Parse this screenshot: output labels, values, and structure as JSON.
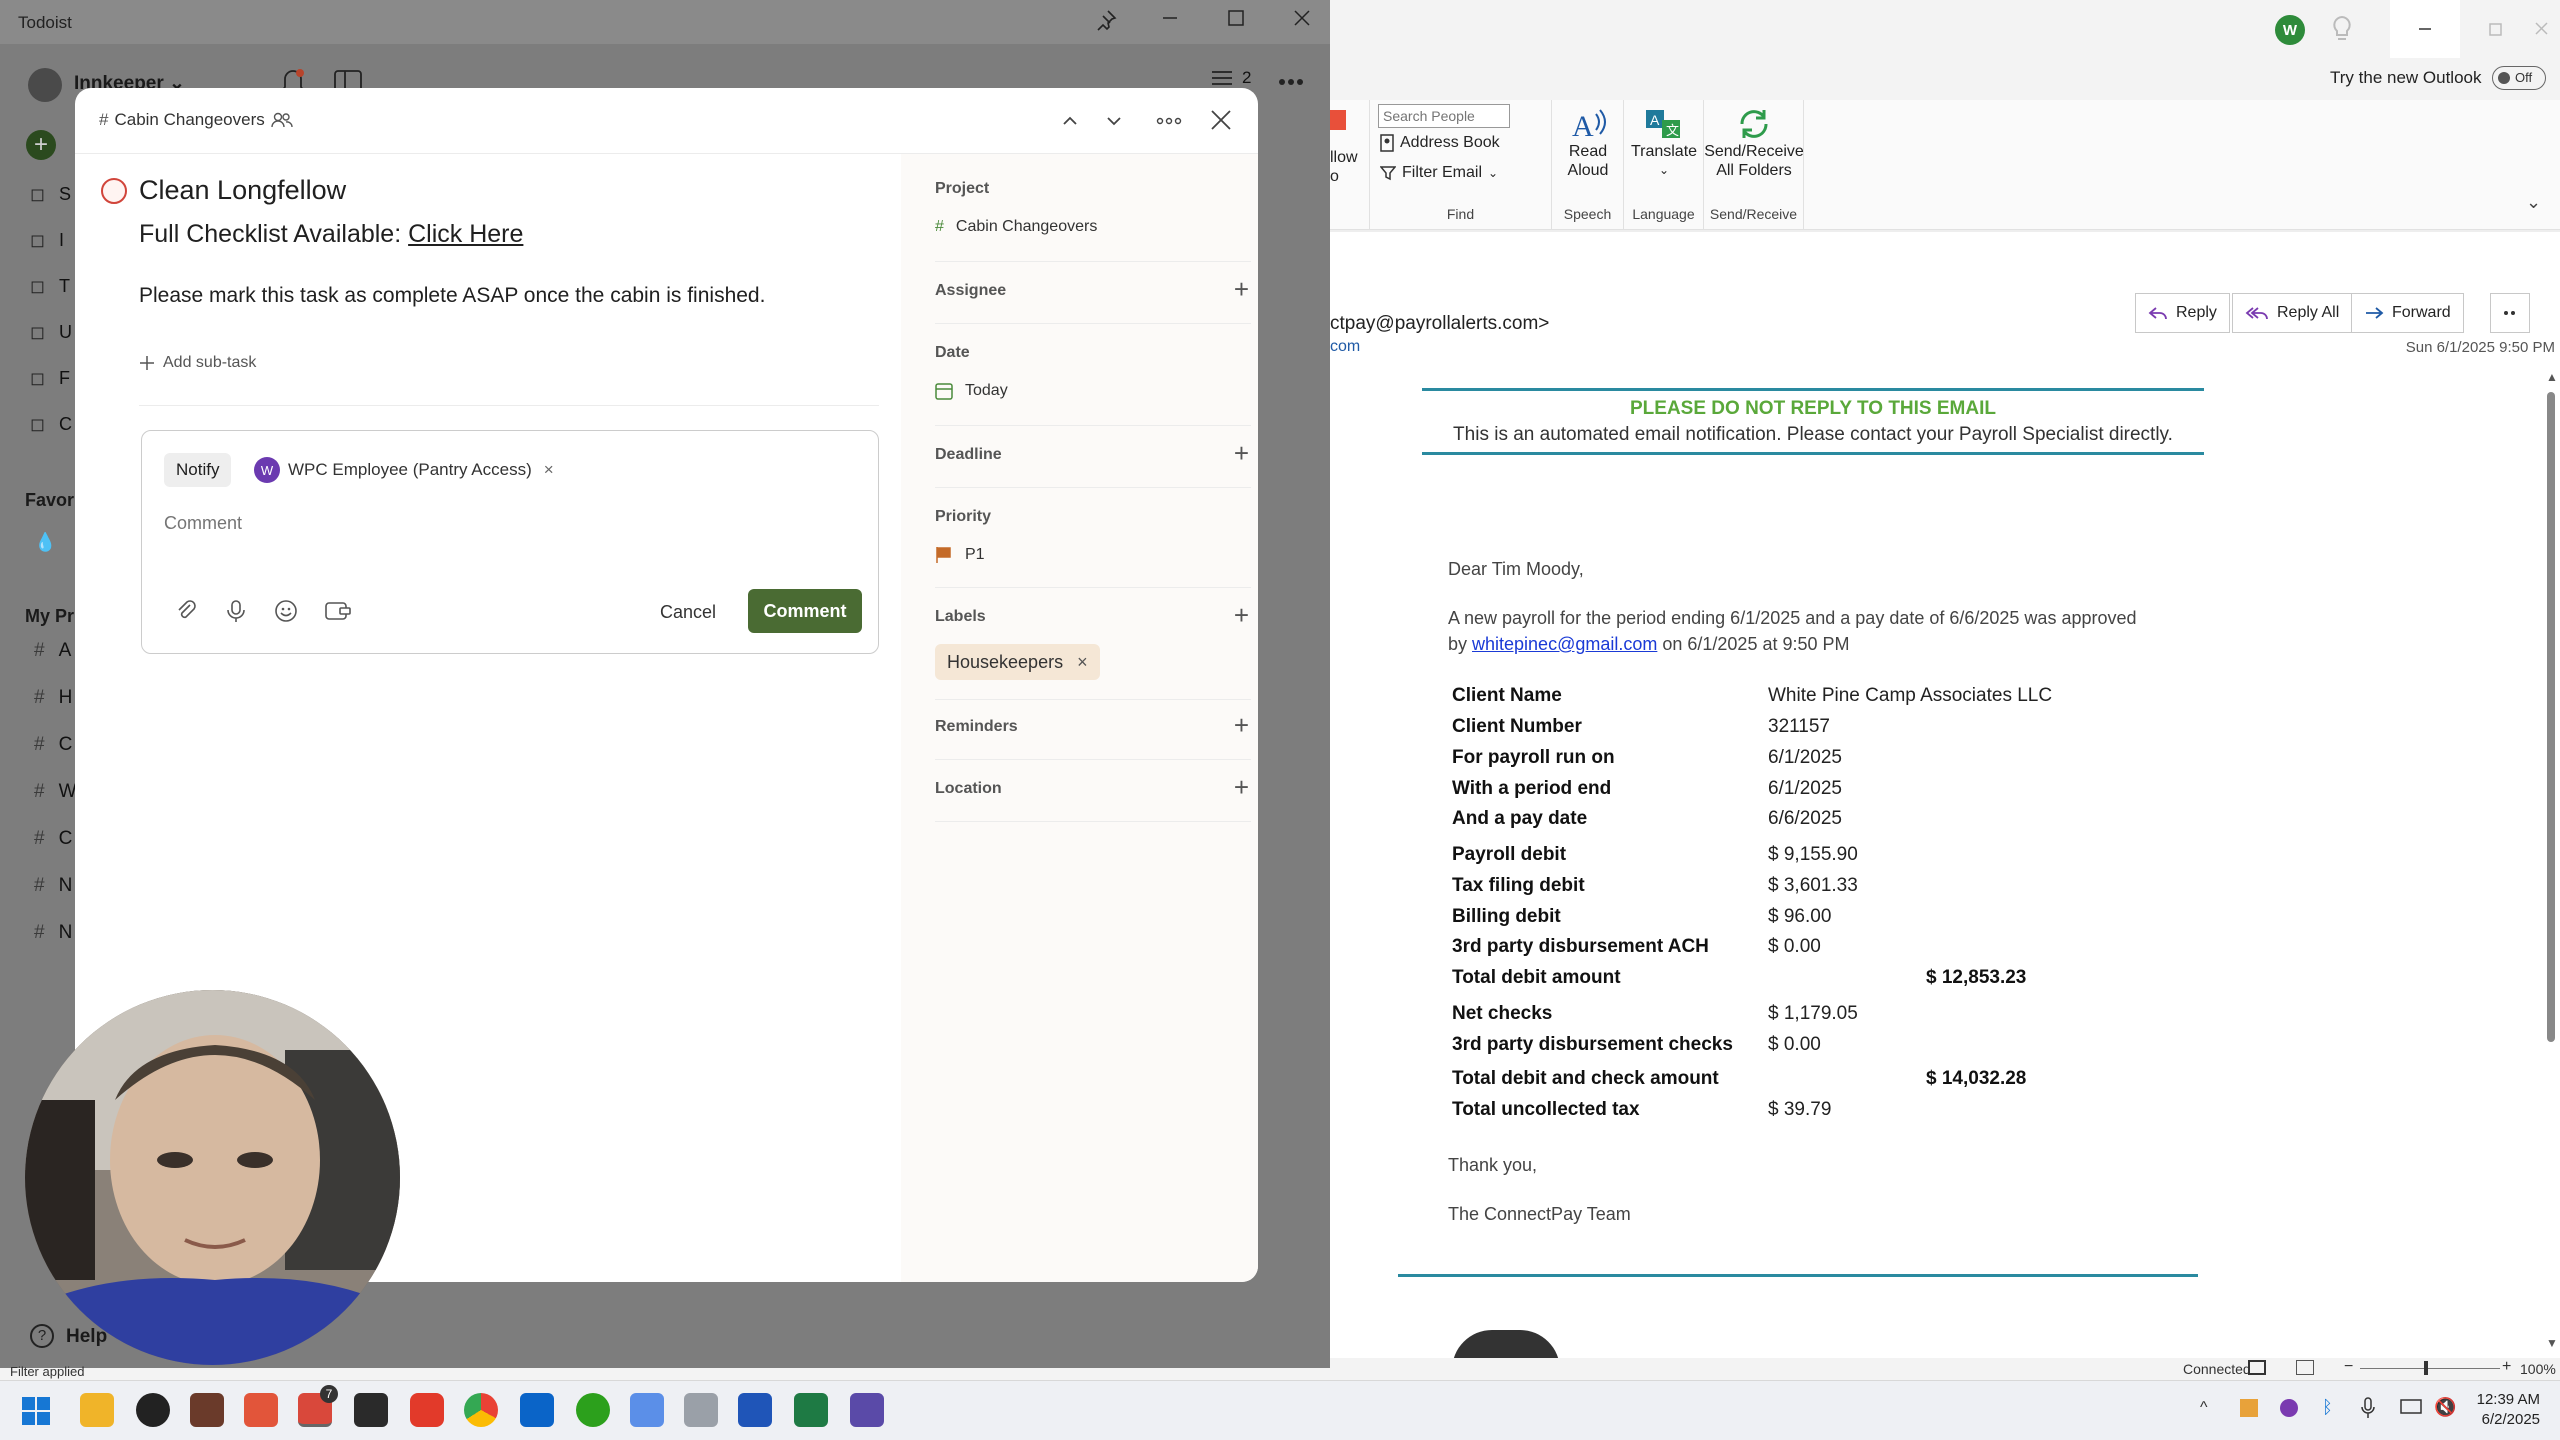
{
  "todoist": {
    "window_title": "Todoist",
    "workspace": "Innkeeper",
    "sidebar_letters": [
      "S",
      "I",
      "T",
      "U",
      "F",
      "C"
    ],
    "favorites_label": "Favori",
    "my_projects_label": "My Pr",
    "project_letters": [
      "A",
      "H",
      "C",
      "W",
      "C",
      "N",
      "N"
    ],
    "help_label": "Help",
    "filter_applied": "Filter applied",
    "top_count": "2"
  },
  "modal": {
    "breadcrumb": "Cabin Changeovers",
    "task_title": "Clean Longfellow",
    "desc_prefix": "Full Checklist Available: ",
    "desc_link": "Click Here",
    "desc_line2": "Please mark this task as complete ASAP once the cabin is finished.",
    "add_subtask": "Add sub-task",
    "notify_label": "Notify",
    "notify_avatar": "W",
    "notify_person": "WPC Employee (Pantry Access)",
    "comment_placeholder": "Comment",
    "cancel_label": "Cancel",
    "comment_button": "Comment",
    "side": {
      "project_label": "Project",
      "project_value": "Cabin Changeovers",
      "assignee_label": "Assignee",
      "date_label": "Date",
      "date_value": "Today",
      "deadline_label": "Deadline",
      "priority_label": "Priority",
      "priority_value": "P1",
      "labels_label": "Labels",
      "label_chip": "Housekeepers",
      "reminders_label": "Reminders",
      "location_label": "Location"
    }
  },
  "outlook": {
    "account_avatar": "W",
    "try_new": "Try the new Outlook",
    "toggle": "Off",
    "ribbon": {
      "follow_label_1": "llow",
      "follow_label_2": "o",
      "search_people_placeholder": "Search People",
      "address_book": "Address Book",
      "filter_email": "Filter Email",
      "find_group": "Find",
      "read_aloud_1": "Read",
      "read_aloud_2": "Aloud",
      "speech_group": "Speech",
      "translate": "Translate",
      "language_group": "Language",
      "send_receive_1": "Send/Receive",
      "send_receive_2": "All Folders",
      "send_receive_group": "Send/Receive"
    },
    "sender": "ctpay@payrollalerts.com>",
    "sender_line2": "com",
    "reply": "Reply",
    "reply_all": "Reply All",
    "forward": "Forward",
    "received": "Sun 6/1/2025 9:50 PM",
    "banner_title": "PLEASE DO NOT REPLY TO THIS EMAIL",
    "banner_text": "This is an automated email notification. Please contact your Payroll Specialist directly.",
    "greeting": "Dear Tim Moody,",
    "intro_1": "A new payroll for the period ending 6/1/2025 and a pay date of 6/6/2025 was approved",
    "intro_by": "by ",
    "intro_link": "whitepinec@gmail.com",
    "intro_tail": " on 6/1/2025 at 9:50 PM",
    "rows": [
      {
        "label": "Client Name",
        "value": "White Pine Camp Associates LLC",
        "total": ""
      },
      {
        "label": "Client Number",
        "value": "321157",
        "total": ""
      },
      {
        "label": "For payroll run on",
        "value": "6/1/2025",
        "total": ""
      },
      {
        "label": "With a period end",
        "value": "6/1/2025",
        "total": ""
      },
      {
        "label": "And a pay date",
        "value": "6/6/2025",
        "total": ""
      },
      {
        "label": "Payroll debit",
        "value": "$ 9,155.90",
        "total": ""
      },
      {
        "label": "Tax filing debit",
        "value": "$ 3,601.33",
        "total": ""
      },
      {
        "label": "Billing debit",
        "value": "$ 96.00",
        "total": ""
      },
      {
        "label": "3rd party disbursement ACH",
        "value": "$ 0.00",
        "total": ""
      },
      {
        "label": "Total debit amount",
        "value": "",
        "total": "$ 12,853.23"
      },
      {
        "label": "Net checks",
        "value": "$ 1,179.05",
        "total": ""
      },
      {
        "label": "3rd party disbursement checks",
        "value": "$ 0.00",
        "total": ""
      },
      {
        "label": "Total debit and check amount",
        "value": "",
        "total": "$ 14,032.28"
      },
      {
        "label": "Total uncollected tax",
        "value": "$ 39.79",
        "total": ""
      }
    ],
    "thanks": "Thank you,",
    "signature": "The ConnectPay Team",
    "status_connected": "Connected",
    "zoom": "100%"
  },
  "taskbar": {
    "time": "12:39 AM",
    "date": "6/2/2025",
    "todoist_badge": "7"
  }
}
